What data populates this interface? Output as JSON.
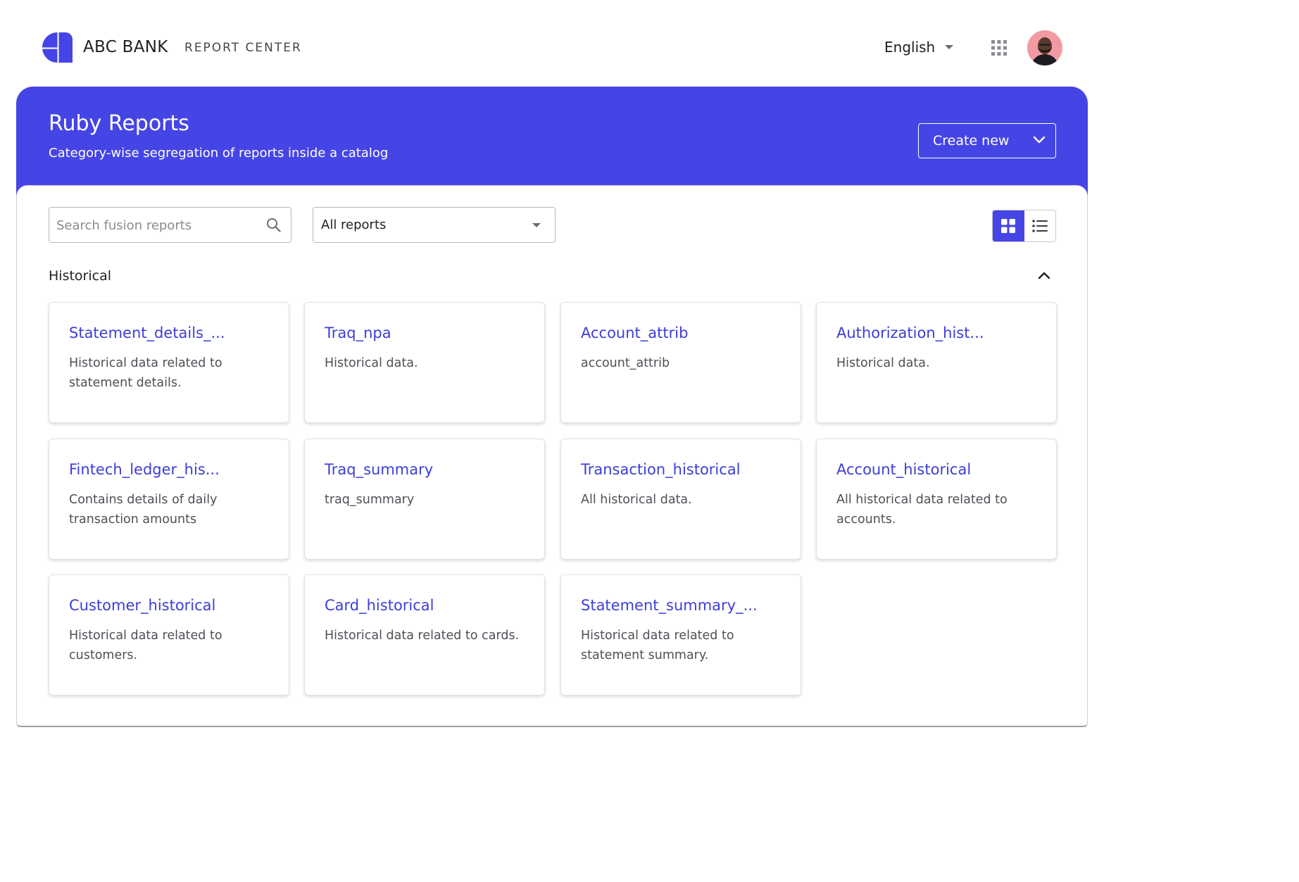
{
  "header": {
    "brand": "ABC BANK",
    "subbrand": "REPORT CENTER",
    "language": "English",
    "colors": {
      "accent": "#4545e6"
    }
  },
  "banner": {
    "title": "Ruby Reports",
    "subtitle": "Category-wise segregation of reports inside a catalog",
    "create_label": "Create new"
  },
  "toolbar": {
    "search_placeholder": "Search fusion reports",
    "filter_value": "All reports"
  },
  "section": {
    "title": "Historical",
    "reports": [
      {
        "title": "Statement_details_...",
        "description": "Historical data related to statement details."
      },
      {
        "title": "Traq_npa",
        "description": "Historical data."
      },
      {
        "title": "Account_attrib",
        "description": "account_attrib"
      },
      {
        "title": "Authorization_hist...",
        "description": "Historical data."
      },
      {
        "title": "Fintech_ledger_his...",
        "description": "Contains details of daily transaction amounts"
      },
      {
        "title": "Traq_summary",
        "description": "traq_summary"
      },
      {
        "title": "Transaction_historical",
        "description": "All historical data."
      },
      {
        "title": "Account_historical",
        "description": "All historical data related to accounts."
      },
      {
        "title": "Customer_historical",
        "description": "Historical data related to customers."
      },
      {
        "title": "Card_historical",
        "description": "Historical data related to cards."
      },
      {
        "title": "Statement_summary_...",
        "description": "Historical data related to statement summary."
      }
    ]
  }
}
